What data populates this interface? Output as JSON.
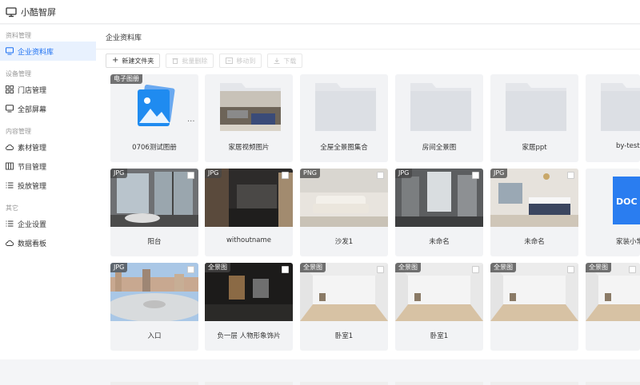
{
  "app": {
    "title": "小酷智屏"
  },
  "sidebar": {
    "groups": [
      {
        "title": "资料管理",
        "items": [
          {
            "label": "企业资料库",
            "icon": "monitor-icon"
          }
        ]
      },
      {
        "title": "设备管理",
        "items": [
          {
            "label": "门店管理",
            "icon": "grid-icon"
          },
          {
            "label": "全部屏幕",
            "icon": "screen-icon"
          }
        ]
      },
      {
        "title": "内容管理",
        "items": [
          {
            "label": "素材管理",
            "icon": "cloud-icon"
          },
          {
            "label": "节目管理",
            "icon": "program-icon"
          },
          {
            "label": "投放管理",
            "icon": "list-icon"
          }
        ]
      },
      {
        "title": "其它",
        "items": [
          {
            "label": "企业设置",
            "icon": "list-icon"
          },
          {
            "label": "数据看板",
            "icon": "cloud-icon"
          }
        ]
      }
    ]
  },
  "main": {
    "breadcrumb": "企业资料库",
    "toolbar": {
      "new_folder": "新建文件夹",
      "batch_delete": "批量删除",
      "move_to": "移动到",
      "download": "下载"
    },
    "items": [
      {
        "name": "0706测试图册",
        "badge": "电子图册",
        "kind": "album"
      },
      {
        "name": "家居视频图片",
        "badge": "",
        "kind": "folder-photo"
      },
      {
        "name": "全屋全景图集合",
        "badge": "",
        "kind": "folder"
      },
      {
        "name": "房间全景图",
        "badge": "",
        "kind": "folder"
      },
      {
        "name": "家居ppt",
        "badge": "",
        "kind": "folder"
      },
      {
        "name": "by-test",
        "badge": "",
        "kind": "folder"
      },
      {
        "name": "阳台",
        "badge": "JPG",
        "kind": "photo-balcony"
      },
      {
        "name": "withoutname",
        "badge": "JPG",
        "kind": "photo-kitchen"
      },
      {
        "name": "沙发1",
        "badge": "PNG",
        "kind": "photo-sofa"
      },
      {
        "name": "未命名",
        "badge": "JPG",
        "kind": "photo-bath"
      },
      {
        "name": "未命名",
        "badge": "JPG",
        "kind": "photo-bedroom"
      },
      {
        "name": "家装小常",
        "badge": "",
        "kind": "doc",
        "doc_label": "DOC"
      },
      {
        "name": "入口",
        "badge": "JPG",
        "kind": "pano-city"
      },
      {
        "name": "负一层 人物形象饰片",
        "badge": "全景图",
        "kind": "pano-dark"
      },
      {
        "name": "卧室1",
        "badge": "全景图",
        "kind": "pano-room"
      },
      {
        "name": "卧室1",
        "badge": "全景图",
        "kind": "pano-room"
      },
      {
        "name": "",
        "badge": "全景图",
        "kind": "pano-room"
      },
      {
        "name": "",
        "badge": "全景图",
        "kind": "pano-room"
      }
    ]
  },
  "colors": {
    "accent": "#1a6ff2",
    "active_bg": "#e8f1fe",
    "card_bg": "#f2f3f5"
  }
}
